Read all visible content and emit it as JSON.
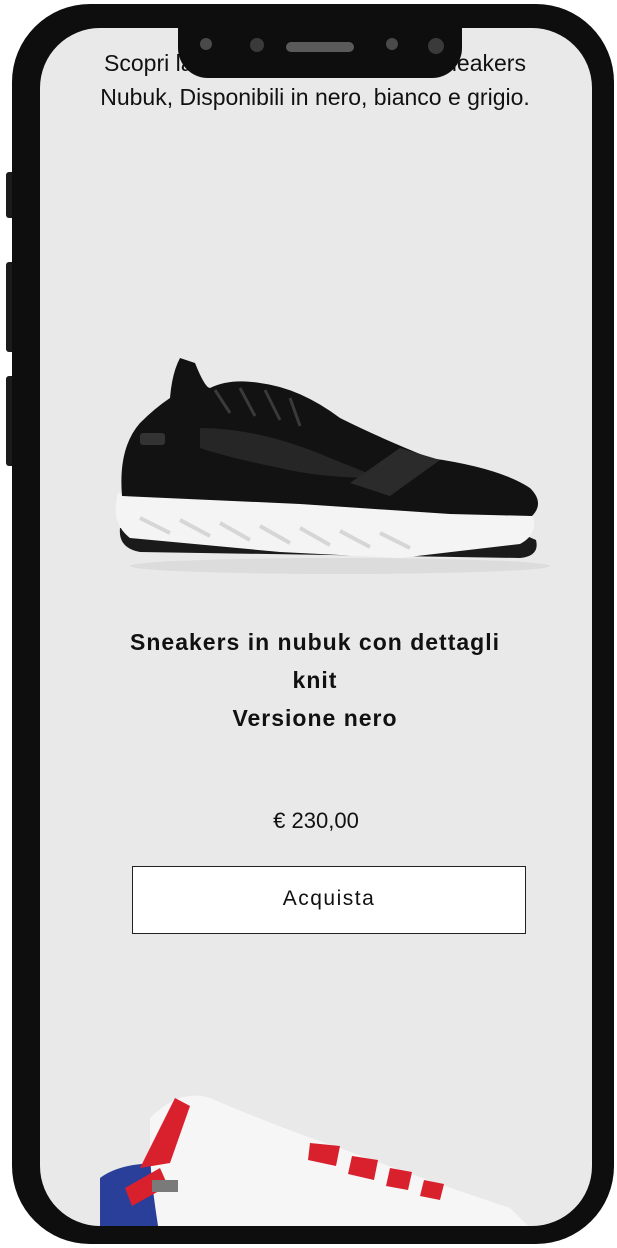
{
  "intro_text": "Scopri la collezione delle nuove sneakers Nubuk, Disponibili in nero, bianco e grigio.",
  "product": {
    "title_line1": "Sneakers in nubuk con dettagli",
    "title_line2": "knit",
    "title_line3": "Versione nero",
    "price": "€ 230,00",
    "buy_label": "Acquista"
  },
  "colors": {
    "screen_background": "#e9e9e9",
    "phone_frame": "#0e0e0e",
    "button_background": "#ffffff",
    "accent_red": "#d9202d",
    "accent_blue": "#2a3f9a"
  },
  "icons": {
    "camera": "front-camera-icon",
    "speaker": "earpiece-speaker-icon"
  }
}
